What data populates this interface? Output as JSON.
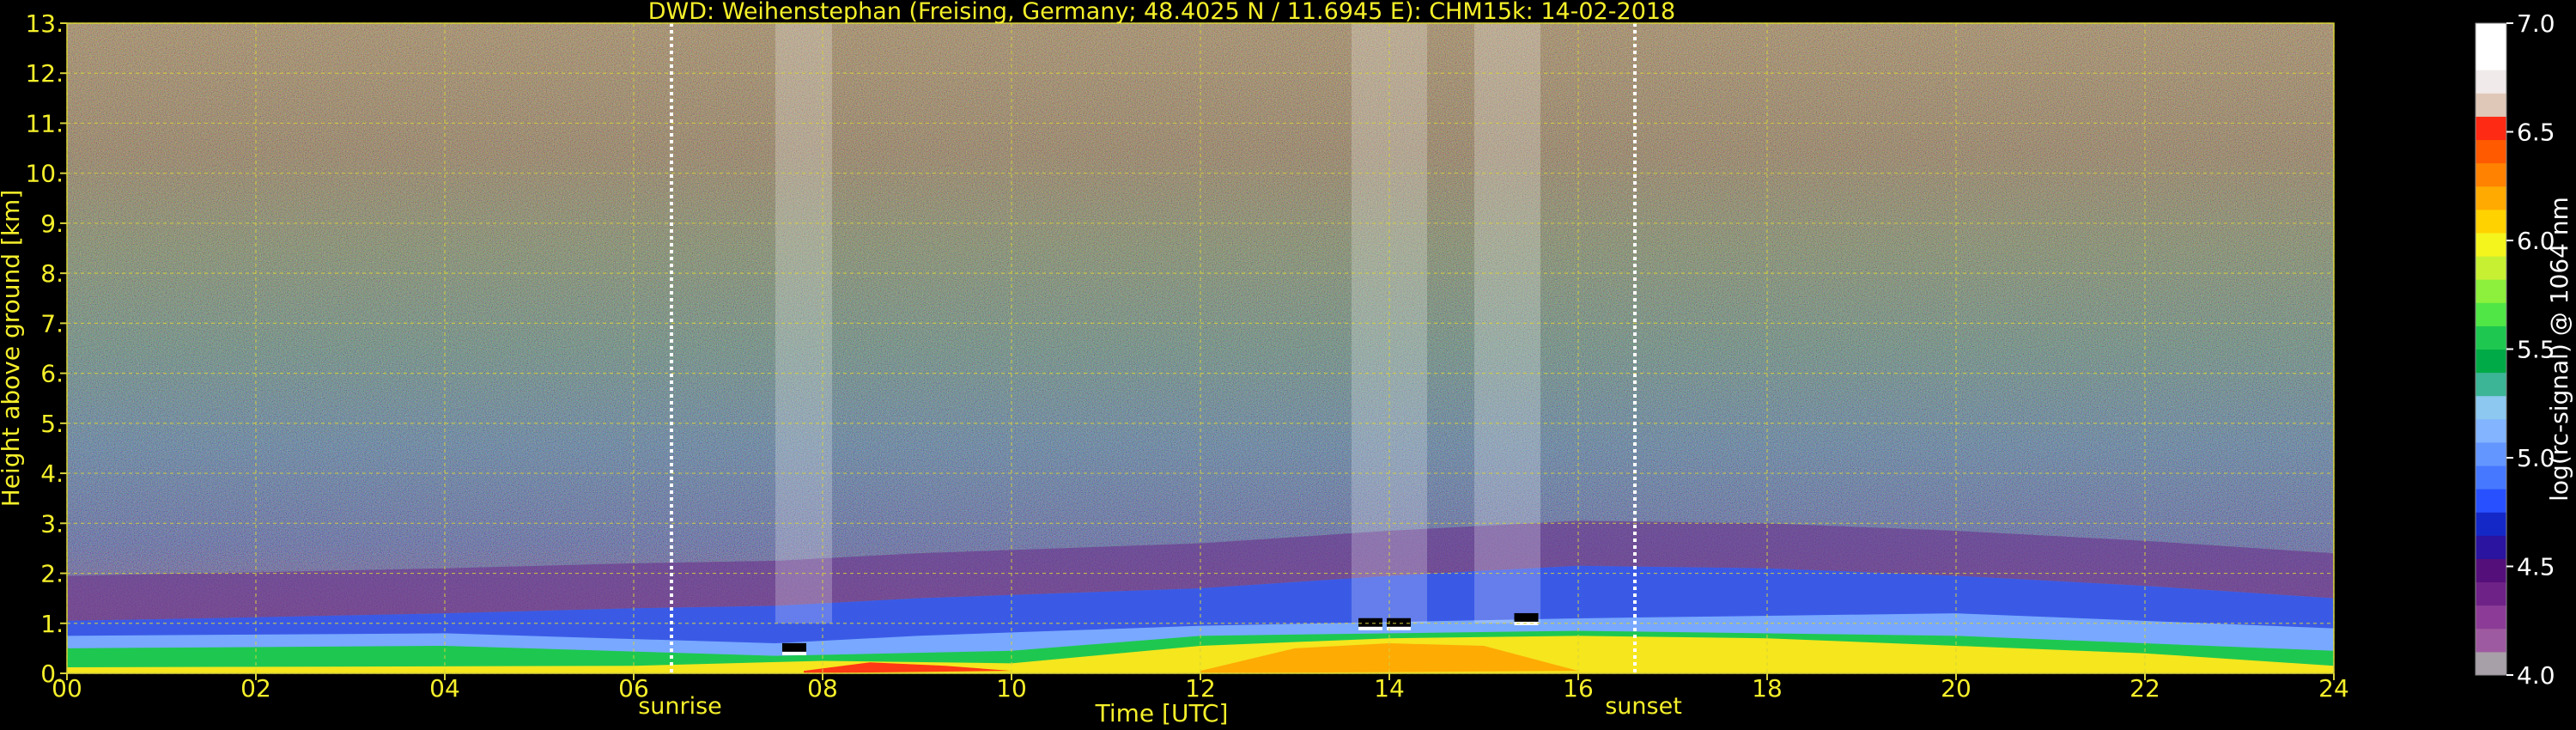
{
  "chart_data": {
    "type": "heatmap",
    "title": "DWD: Weihenstephan (Freising, Germany; 48.4025 N / 11.6945 E):    CHM15k: 14-02-2018",
    "xlabel": "Time [UTC]",
    "ylabel": "Height above ground [km]",
    "x_ticks": [
      "00",
      "02",
      "04",
      "06",
      "08",
      "10",
      "12",
      "14",
      "16",
      "18",
      "20",
      "22",
      "24"
    ],
    "y_ticks": [
      "0.",
      "1.",
      "2.",
      "3.",
      "4.",
      "5.",
      "6.",
      "7.",
      "8.",
      "9.",
      "10.",
      "11.",
      "12.",
      "13."
    ],
    "xlim": [
      0,
      24
    ],
    "ylim": [
      0,
      13
    ],
    "grid": true,
    "colorbar": {
      "label": "log(rc-signal) @ 1064 nm",
      "range": [
        4.0,
        7.0
      ],
      "ticks": [
        "4.0",
        "4.5",
        "5.0",
        "5.5",
        "6.0",
        "6.5",
        "7.0"
      ],
      "colors": [
        "#a8a0a8",
        "#9e5aa0",
        "#8c3c96",
        "#6e2287",
        "#550f7a",
        "#2a14a0",
        "#1428c8",
        "#2850ff",
        "#4678ff",
        "#6496ff",
        "#82b4ff",
        "#8cc8f0",
        "#3cb496",
        "#00aa46",
        "#1ec850",
        "#50e646",
        "#8cf03c",
        "#c8f032",
        "#f5f51e",
        "#ffd200",
        "#ffaa00",
        "#ff8200",
        "#ff5a00",
        "#ff2a14",
        "#e0c8b8",
        "#f0eaea",
        "#ffffff",
        "#ffffff"
      ]
    },
    "annotations": [
      {
        "text": "sunrise",
        "x": 6.4
      },
      {
        "text": "sunset",
        "x": 16.6
      }
    ],
    "layers": [
      {
        "name": "boundary layer top",
        "x": [
          0,
          2,
          4,
          6,
          7.5,
          9,
          12,
          14,
          16,
          18,
          20,
          22,
          24
        ],
        "y": [
          1.05,
          1.12,
          1.2,
          1.3,
          1.35,
          1.5,
          1.7,
          1.95,
          2.15,
          2.1,
          1.95,
          1.75,
          1.5
        ]
      },
      {
        "name": "clouds",
        "x": [
          7.7,
          13.8,
          14.1,
          15.45
        ],
        "y": [
          0.5,
          1.0,
          1.0,
          1.1
        ]
      }
    ],
    "cloud_columns_x": [
      [
        7.5,
        8.1
      ],
      [
        13.6,
        14.4
      ],
      [
        14.9,
        15.6
      ]
    ]
  }
}
